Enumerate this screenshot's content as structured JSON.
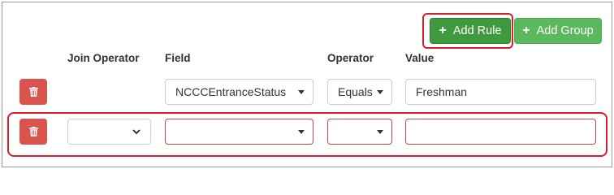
{
  "toolbar": {
    "add_rule_label": "Add Rule",
    "add_group_label": "Add Group",
    "plus_glyph": "+"
  },
  "headers": {
    "join_operator": "Join Operator",
    "field": "Field",
    "operator": "Operator",
    "value": "Value"
  },
  "rows": [
    {
      "join_operator": "",
      "field": "NCCCEntranceStatus",
      "operator": "Equals",
      "value": "Freshman"
    },
    {
      "join_operator": "",
      "field": "",
      "operator": "",
      "value": ""
    }
  ],
  "colors": {
    "add_rule": "#3f9a3f",
    "add_group": "#5cb85c",
    "delete": "#d9534f",
    "highlight": "#d4202a",
    "invalid_border": "#b94a48"
  },
  "icons": {
    "add": "plus-icon",
    "delete": "trash-icon",
    "dropdown": "caret-down-icon",
    "join_dropdown": "chevron-down-icon"
  }
}
